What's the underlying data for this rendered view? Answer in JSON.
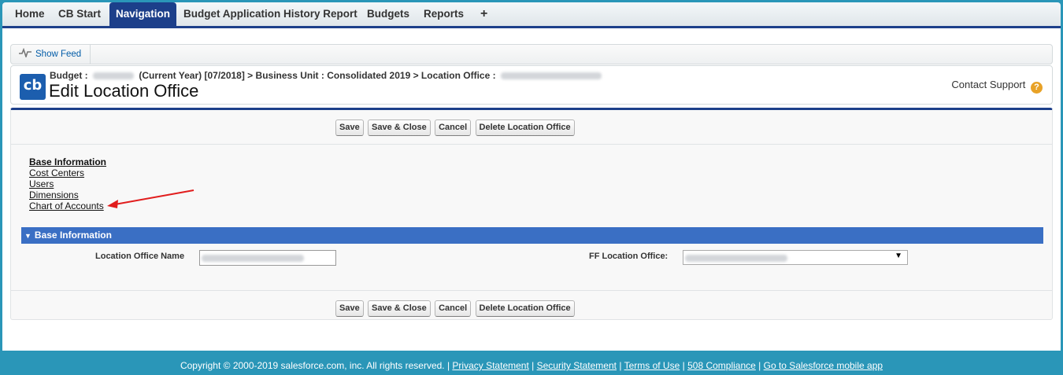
{
  "tabs": [
    {
      "label": "Home",
      "active": false
    },
    {
      "label": "CB Start",
      "active": false
    },
    {
      "label": "Navigation",
      "active": true
    },
    {
      "label": "Budget Application History Report",
      "active": false
    },
    {
      "label": "Budgets",
      "active": false
    },
    {
      "label": "Reports",
      "active": false
    },
    {
      "label": "+",
      "active": false
    }
  ],
  "feed": {
    "label": "Show Feed"
  },
  "header": {
    "logo_text": "cb",
    "crumb_prefix": "Budget :",
    "crumb_year": "(Current Year) [07/2018] > Business Unit : Consolidated 2019 > Location Office :",
    "title": "Edit Location Office",
    "support": "Contact Support",
    "help_glyph": "?"
  },
  "buttons": {
    "save": "Save",
    "save_close": "Save & Close",
    "cancel": "Cancel",
    "delete": "Delete Location Office"
  },
  "nav_links": {
    "base": "Base Information",
    "cost_centers": "Cost Centers",
    "users": "Users",
    "dimensions": "Dimensions",
    "chart": "Chart of Accounts"
  },
  "section": {
    "caret": "▼",
    "title": "Base Information"
  },
  "form": {
    "name_label": "Location Office Name",
    "ff_label": "FF Location Office:",
    "dropdown_glyph": "▼"
  },
  "footer": {
    "copyright": "Copyright © 2000-2019 salesforce.com, inc. All rights reserved. |",
    "privacy": "Privacy Statement",
    "security": "Security Statement",
    "terms": "Terms of Use",
    "compliance": "508 Compliance",
    "mobile": "Go to Salesforce mobile app",
    "sep": "|"
  },
  "colors": {
    "nav_active": "#1c3f8a",
    "section_bar": "#3a6fc4",
    "background": "#2a96b8",
    "annotation_arrow": "#e11d1d"
  }
}
